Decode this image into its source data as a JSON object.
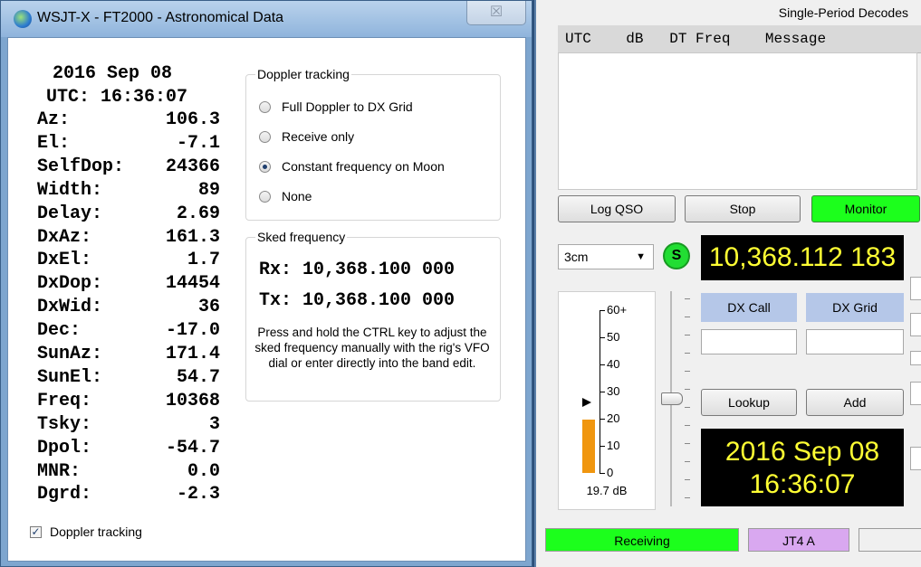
{
  "astro_window": {
    "title": "WSJT-X - FT2000 - Astronomical Data",
    "close_glyph": "☒",
    "date": "2016 Sep 08",
    "utc": "UTC: 16:36:07",
    "rows": [
      {
        "label": "Az:",
        "value": "106.3"
      },
      {
        "label": "El:",
        "value": "-7.1"
      },
      {
        "label": "SelfDop:",
        "value": "24366"
      },
      {
        "label": "Width:",
        "value": "89"
      },
      {
        "label": "Delay:",
        "value": "2.69"
      },
      {
        "label": "DxAz:",
        "value": "161.3"
      },
      {
        "label": "DxEl:",
        "value": "1.7"
      },
      {
        "label": "DxDop:",
        "value": "14454"
      },
      {
        "label": "DxWid:",
        "value": "36"
      },
      {
        "label": "Dec:",
        "value": "-17.0"
      },
      {
        "label": "SunAz:",
        "value": "171.4"
      },
      {
        "label": "SunEl:",
        "value": "54.7"
      },
      {
        "label": "Freq:",
        "value": "10368"
      },
      {
        "label": "Tsky:",
        "value": "3"
      },
      {
        "label": "Dpol:",
        "value": "-54.7"
      },
      {
        "label": "MNR:",
        "value": "0.0"
      },
      {
        "label": "Dgrd:",
        "value": "-2.3"
      }
    ],
    "doppler_group": {
      "title": "Doppler tracking",
      "options": [
        {
          "label": "Full Doppler to DX Grid",
          "selected": false
        },
        {
          "label": "Receive only",
          "selected": false
        },
        {
          "label": "Constant frequency on Moon",
          "selected": true
        },
        {
          "label": "None",
          "selected": false
        }
      ]
    },
    "sked_group": {
      "title": "Sked frequency",
      "rx": "Rx: 10,368.100 000",
      "tx": "Tx: 10,368.100 000",
      "help": "Press and hold the CTRL key to adjust the sked frequency manually with the rig's VFO dial or enter directly into the band edit."
    },
    "doppler_checkbox": {
      "label": "Doppler tracking",
      "checked": true
    }
  },
  "main_window": {
    "decodes_title": "Single-Period Decodes",
    "decodes_columns": "UTC    dB   DT Freq    Message",
    "buttons": {
      "log_qso": "Log QSO",
      "stop": "Stop",
      "monitor": "Monitor",
      "lookup": "Lookup",
      "add": "Add"
    },
    "band": "3cm",
    "s_indicator": "S",
    "frequency": "10,368.112 183",
    "meter": {
      "ticks": [
        "60+",
        "50",
        "40",
        "30",
        "20",
        "10",
        "0"
      ],
      "level_db": 19.7,
      "readout": "19.7 dB",
      "max_db": 60,
      "arrow_db": 26
    },
    "dx_call_label": "DX Call",
    "dx_grid_label": "DX Grid",
    "date_display": "2016 Sep 08",
    "time_display": "16:36:07",
    "status": {
      "receiving": "Receiving",
      "mode": "JT4 A"
    },
    "colors": {
      "monitor": "#1cff1c",
      "receiving": "#1cff1c",
      "mode": "#d9a8f0",
      "display_bg": "#000000",
      "display_fg": "#ffff33",
      "meter_bar": "#f0960f"
    }
  }
}
